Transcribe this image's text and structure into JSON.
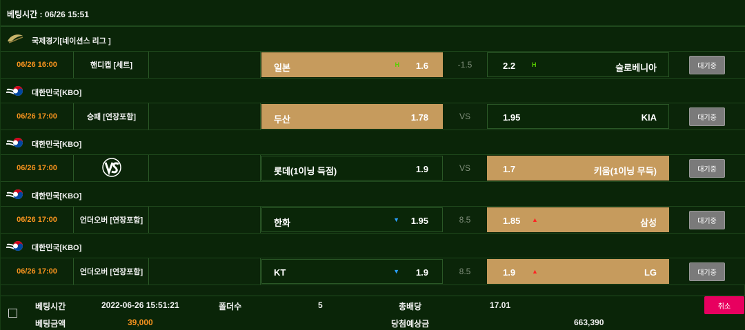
{
  "header": {
    "title": "베팅시간 : 06/26 15:51"
  },
  "games": [
    {
      "league": "국제경기[네이션스 리그 ]",
      "league_icon": "volleyball-icon",
      "time": "06/26 16:00",
      "type": "핸디캡 [세트]",
      "home": {
        "name": "일본",
        "odds": "1.6",
        "indicator": "H",
        "selected": true
      },
      "mid": "-1.5",
      "away": {
        "name": "슬로베니아",
        "odds": "2.2",
        "indicator": "H",
        "selected": false
      },
      "status": "대기중"
    },
    {
      "league": "대한민국[KBO]",
      "league_icon": "korea-flag-baseball-icon",
      "time": "06/26 17:00",
      "type": "승패 [연장포함]",
      "home": {
        "name": "두산",
        "odds": "1.78",
        "indicator": "",
        "selected": true
      },
      "mid": "VS",
      "away": {
        "name": "KIA",
        "odds": "1.95",
        "indicator": "",
        "selected": false
      },
      "status": "대기중"
    },
    {
      "league": "대한민국[KBO]",
      "league_icon": "korea-flag-baseball-icon",
      "time": "06/26 17:00",
      "type": "",
      "type_icon": "vs-icon",
      "home": {
        "name": "롯데(1이닝 득점)",
        "odds": "1.9",
        "indicator": "",
        "selected": false
      },
      "mid": "VS",
      "away": {
        "name": "키움(1이닝 무득)",
        "odds": "1.7",
        "indicator": "",
        "selected": true
      },
      "status": "대기중"
    },
    {
      "league": "대한민국[KBO]",
      "league_icon": "korea-flag-baseball-icon",
      "time": "06/26 17:00",
      "type": "언더오버 [연장포함]",
      "home": {
        "name": "한화",
        "odds": "1.95",
        "indicator": "down",
        "selected": false
      },
      "mid": "8.5",
      "away": {
        "name": "삼성",
        "odds": "1.85",
        "indicator": "up",
        "selected": true
      },
      "status": "대기중"
    },
    {
      "league": "대한민국[KBO]",
      "league_icon": "korea-flag-baseball-icon",
      "time": "06/26 17:00",
      "type": "언더오버 [연장포함]",
      "home": {
        "name": "KT",
        "odds": "1.9",
        "indicator": "down",
        "selected": false
      },
      "mid": "8.5",
      "away": {
        "name": "LG",
        "odds": "1.9",
        "indicator": "up",
        "selected": true
      },
      "status": "대기중"
    }
  ],
  "summary": {
    "bet_time_label": "베팅시간",
    "bet_time_value": "2022-06-26 15:51:21",
    "folders_label": "폴더수",
    "folders_value": "5",
    "total_odds_label": "총배당",
    "total_odds_value": "17.01",
    "bet_amount_label": "베팅금액",
    "bet_amount_value": "39,000",
    "expected_win_label": "당첨예상금",
    "expected_win_value": "663,390",
    "cancel_label": "취소"
  },
  "colors": {
    "background": "#0b2409",
    "selected_cell": "#c69b5d",
    "time_text": "#f7931e",
    "cancel_button": "#e8005f",
    "wait_button": "#7a7a7a"
  }
}
